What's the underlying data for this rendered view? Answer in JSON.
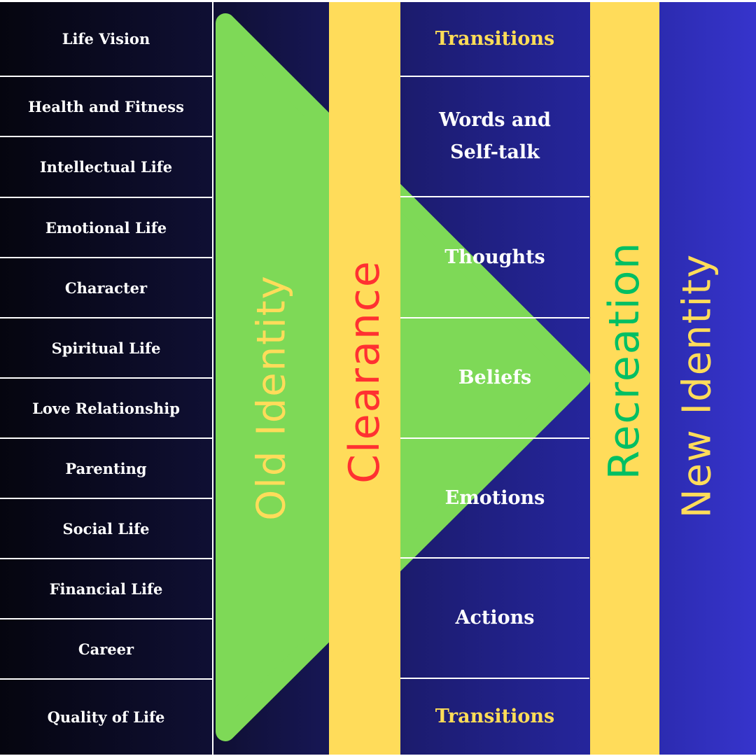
{
  "left_column": [
    "Life Vision",
    "Health and Fitness",
    "Intellectual Life",
    "Emotional Life",
    "Character",
    "Spiritual Life",
    "Love Relationship",
    "Parenting",
    "Social Life",
    "Financial Life",
    "Career",
    "Quality of Life"
  ],
  "middle_column": [
    "Transitions",
    "Words and Self-talk",
    "Thoughts",
    "Beliefs",
    "Emotions",
    "Actions",
    "Transitions"
  ],
  "vertical_labels": {
    "old": "Old Identity",
    "clearance": "Clearance",
    "recreation": "Recreation",
    "new": "New Identity"
  },
  "colors": {
    "green": "#7ed957",
    "yellow": "#ffdc5a",
    "red": "#ff3131",
    "recreation_green": "#00bf63",
    "text_yellow": "#ffdd57"
  }
}
